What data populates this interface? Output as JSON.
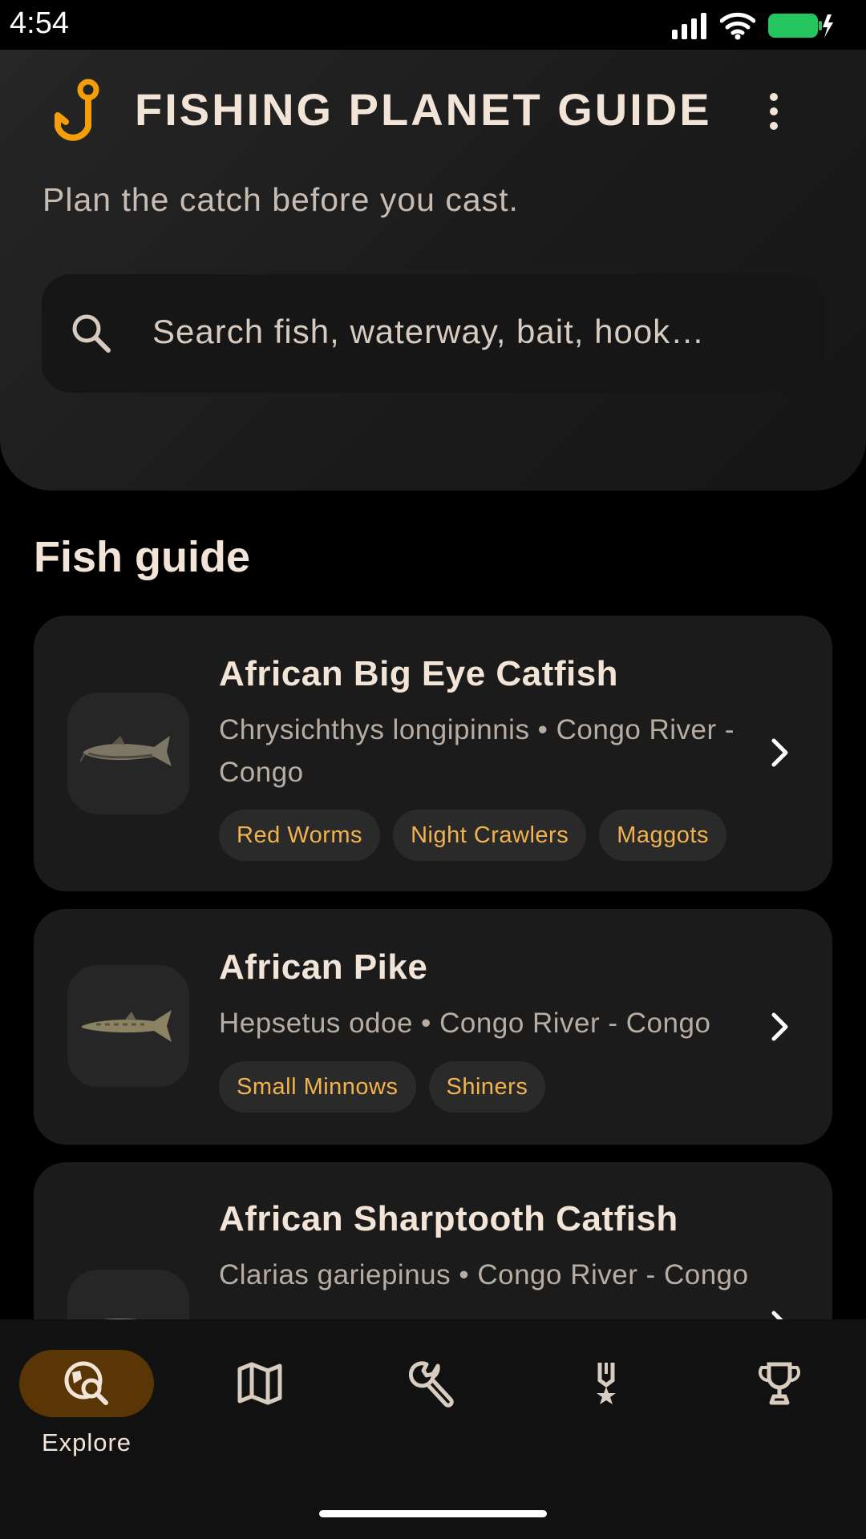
{
  "status_bar": {
    "time": "4:54",
    "battery_color": "#22c55e"
  },
  "header": {
    "logo_icon": "fishing-hook-icon",
    "title": "FISHING PLANET GUIDE",
    "menu_icon": "more-vertical-icon",
    "tagline": "Plan the catch before you cast.",
    "search_placeholder": "Search fish, waterway, bait, hook…"
  },
  "section": {
    "title": "Fish guide"
  },
  "fish": [
    {
      "name": "African Big Eye Catfish",
      "subtitle": "Chrysichthys longipinnis • Congo River - Congo",
      "baits": [
        "Red Worms",
        "Night Crawlers",
        "Maggots"
      ]
    },
    {
      "name": "African Pike",
      "subtitle": "Hepsetus odoe • Congo River - Congo",
      "baits": [
        "Small Minnows",
        "Shiners"
      ]
    },
    {
      "name": "African Sharptooth Catfish",
      "subtitle": "Clarias gariepinus • Congo River - Congo",
      "baits": []
    }
  ],
  "nav": {
    "items": [
      {
        "icon": "explore-search-icon",
        "label": "Explore",
        "active": true
      },
      {
        "icon": "map-icon",
        "label": "",
        "active": false
      },
      {
        "icon": "wrench-icon",
        "label": "",
        "active": false
      },
      {
        "icon": "medal-icon",
        "label": "",
        "active": false
      },
      {
        "icon": "trophy-icon",
        "label": "",
        "active": false
      }
    ]
  },
  "colors": {
    "accent": "#f59e0b",
    "chip_text": "#f2b24e",
    "nav_active_bg": "#5a3506"
  }
}
